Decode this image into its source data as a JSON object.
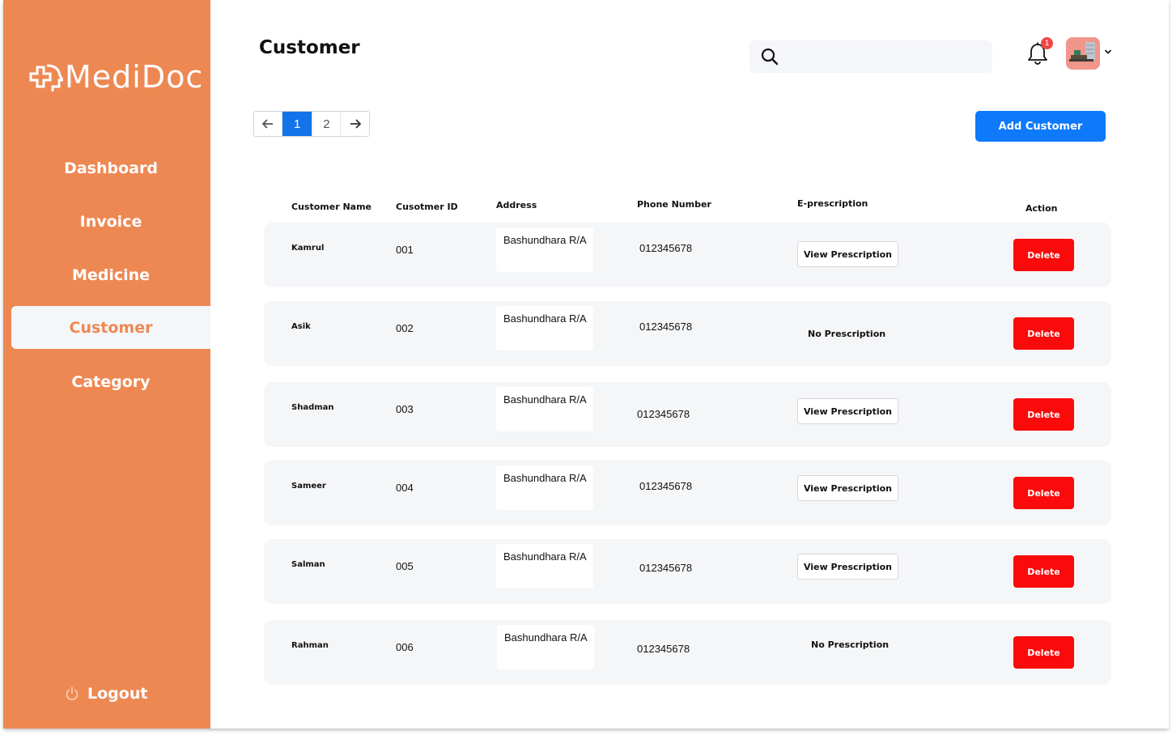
{
  "brand": {
    "name": "MediDoc",
    "accent": "#EE8853"
  },
  "sidebar": {
    "items": [
      {
        "label": "Dashboard",
        "active": false
      },
      {
        "label": "Invoice",
        "active": false
      },
      {
        "label": "Medicine",
        "active": false
      },
      {
        "label": "Customer",
        "active": true
      },
      {
        "label": "Category",
        "active": false
      }
    ],
    "logout_label": "Logout"
  },
  "header": {
    "title": "Customer",
    "search_placeholder": "",
    "notification_count": "1"
  },
  "pagination": {
    "pages": [
      "1",
      "2"
    ],
    "current": "1"
  },
  "add_button_label": "Add Customer",
  "table": {
    "columns": [
      "Customer Name",
      "Cusotmer ID",
      "Address",
      "Phone Number",
      "E-prescription",
      "Action"
    ],
    "rows": [
      {
        "name": "Kamrul",
        "id": "001",
        "address": "Bashundhara R/A",
        "phone": "012345678",
        "prescription": "View Prescription",
        "has_prescription": true,
        "action": "Delete"
      },
      {
        "name": "Asik",
        "id": "002",
        "address": "Bashundhara R/A",
        "phone": "012345678",
        "prescription": "No Prescription",
        "has_prescription": false,
        "action": "Delete"
      },
      {
        "name": "Shadman",
        "id": "003",
        "address": "Bashundhara R/A",
        "phone": "012345678",
        "prescription": "View Prescription",
        "has_prescription": true,
        "action": "Delete"
      },
      {
        "name": "Sameer",
        "id": "004",
        "address": "Bashundhara R/A",
        "phone": "012345678",
        "prescription": "View Prescription",
        "has_prescription": true,
        "action": "Delete"
      },
      {
        "name": "Salman",
        "id": "005",
        "address": "Bashundhara R/A",
        "phone": "012345678",
        "prescription": "View Prescription",
        "has_prescription": true,
        "action": "Delete"
      },
      {
        "name": "Rahman",
        "id": "006",
        "address": "Bashundhara R/A",
        "phone": "012345678",
        "prescription": "No Prescription",
        "has_prescription": false,
        "action": "Delete"
      }
    ]
  },
  "colors": {
    "primary_button": "#0E79FA",
    "delete_button": "#FA0A0A",
    "row_background": "#F5F6F8"
  }
}
